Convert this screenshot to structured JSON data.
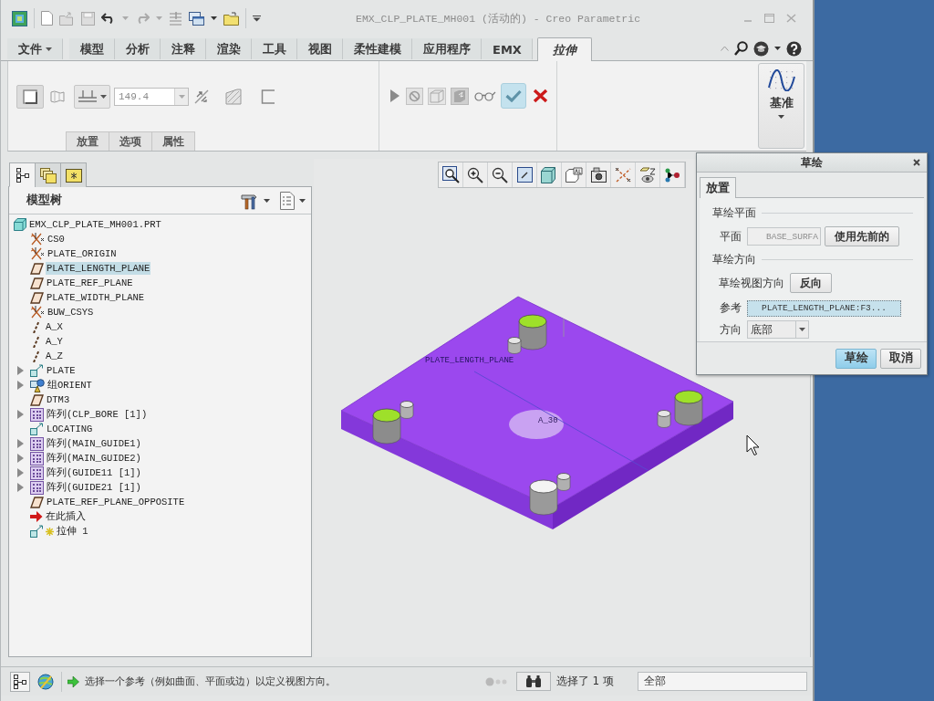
{
  "window": {
    "title": "EMX_CLP_PLATE_MH001 (活动的) - Creo Parametric"
  },
  "ribbon_tabs": [
    {
      "label": "文件",
      "selected": false,
      "dropdown": true
    },
    {
      "label": "模型",
      "selected": false,
      "dropdown": false
    },
    {
      "label": "分析",
      "selected": false,
      "dropdown": false
    },
    {
      "label": "注释",
      "selected": false,
      "dropdown": false
    },
    {
      "label": "渲染",
      "selected": false,
      "dropdown": false
    },
    {
      "label": "工具",
      "selected": false,
      "dropdown": false
    },
    {
      "label": "视图",
      "selected": false,
      "dropdown": false
    },
    {
      "label": "柔性建模",
      "selected": false,
      "dropdown": false
    },
    {
      "label": "应用程序",
      "selected": false,
      "dropdown": false
    },
    {
      "label": "EMX",
      "selected": false,
      "dropdown": false
    },
    {
      "label": "拉伸",
      "selected": true,
      "dropdown": false
    }
  ],
  "ribbon": {
    "toggles": [
      {
        "kind": "solid",
        "selected": true
      },
      {
        "kind": "surface",
        "selected": false
      }
    ],
    "depth": {
      "value": "149.4"
    },
    "sub_tabs": [
      {
        "label": "放置"
      },
      {
        "label": "选项"
      },
      {
        "label": "属性"
      }
    ],
    "confirm": {
      "highlighted": true
    },
    "datum_button": {
      "label": "基准"
    }
  },
  "model_tree_panel": {
    "tabs": [
      {
        "kind": "tree",
        "selected": true
      },
      {
        "kind": "layers",
        "selected": false
      },
      {
        "kind": "favorites",
        "selected": false
      }
    ],
    "title": "模型树",
    "tree": [
      {
        "label": "EMX_CLP_PLATE_MH001.PRT",
        "kind": "part",
        "selected": false,
        "expandable": false,
        "new": false,
        "children": [
          {
            "label": "CS0",
            "kind": "csys",
            "selected": false,
            "expandable": false,
            "new": false
          },
          {
            "label": "PLATE_ORIGIN",
            "kind": "csys",
            "selected": false,
            "expandable": false,
            "new": false
          },
          {
            "label": "PLATE_LENGTH_PLANE",
            "kind": "plane",
            "selected": true,
            "expandable": false,
            "new": false
          },
          {
            "label": "PLATE_REF_PLANE",
            "kind": "plane",
            "selected": false,
            "expandable": false,
            "new": false
          },
          {
            "label": "PLATE_WIDTH_PLANE",
            "kind": "plane",
            "selected": false,
            "expandable": false,
            "new": false
          },
          {
            "label": "BUW_CSYS",
            "kind": "csys",
            "selected": false,
            "expandable": false,
            "new": false
          },
          {
            "label": "A_X",
            "kind": "axis",
            "selected": false,
            "expandable": false,
            "new": false
          },
          {
            "label": "A_Y",
            "kind": "axis",
            "selected": false,
            "expandable": false,
            "new": false
          },
          {
            "label": "A_Z",
            "kind": "axis",
            "selected": false,
            "expandable": false,
            "new": false
          },
          {
            "label": "PLATE",
            "kind": "feature",
            "selected": false,
            "expandable": true,
            "new": false
          },
          {
            "label": "组ORIENT",
            "kind": "group",
            "selected": false,
            "expandable": true,
            "new": false
          },
          {
            "label": "DTM3",
            "kind": "plane",
            "selected": false,
            "expandable": false,
            "new": false
          },
          {
            "label": "阵列(CLP_BORE [1])",
            "kind": "pattern",
            "selected": false,
            "expandable": true,
            "new": false
          },
          {
            "label": "LOCATING",
            "kind": "feature",
            "selected": false,
            "expandable": false,
            "new": false
          },
          {
            "label": "阵列(MAIN_GUIDE1)",
            "kind": "pattern",
            "selected": false,
            "expandable": true,
            "new": false
          },
          {
            "label": "阵列(MAIN_GUIDE2)",
            "kind": "pattern",
            "selected": false,
            "expandable": true,
            "new": false
          },
          {
            "label": "阵列(GUIDE11 [1])",
            "kind": "pattern",
            "selected": false,
            "expandable": true,
            "new": false
          },
          {
            "label": "阵列(GUIDE21 [1])",
            "kind": "pattern",
            "selected": false,
            "expandable": true,
            "new": false
          },
          {
            "label": "PLATE_REF_PLANE_OPPOSITE",
            "kind": "plane",
            "selected": false,
            "expandable": false,
            "new": false
          },
          {
            "label": "在此插入",
            "kind": "insert",
            "selected": false,
            "expandable": false,
            "new": false
          },
          {
            "label": "拉伸 1",
            "kind": "feature",
            "selected": false,
            "expandable": false,
            "new": true
          }
        ]
      }
    ]
  },
  "viewport": {
    "labels": [
      {
        "kind": "plane",
        "text": "PLATE_LENGTH_PLANE"
      },
      {
        "kind": "axis",
        "text": "A_30"
      }
    ]
  },
  "dialog": {
    "title": "草绘",
    "tabs": [
      {
        "label": "放置",
        "selected": true
      }
    ],
    "sketch_plane": {
      "heading": "草绘平面",
      "plane_label": "平面",
      "plane_value": "BASE_SURFA",
      "use_previous_button": "使用先前的"
    },
    "orientation": {
      "heading": "草绘方向",
      "view_direction_label": "草绘视图方向",
      "flip_button": "反向",
      "reference_label": "参考",
      "reference_value": "PLATE_LENGTH_PLANE:F3...",
      "reference_active": true,
      "direction_label": "方向",
      "direction_value": "底部"
    },
    "buttons": [
      {
        "label": "草绘",
        "default": true
      },
      {
        "label": "取消",
        "default": false
      }
    ]
  },
  "status_bar": {
    "message": "选择一个参考（例如曲面、平面或边）以定义视图方向。",
    "selection_count": "选择了 1 项",
    "filter": "全部"
  }
}
